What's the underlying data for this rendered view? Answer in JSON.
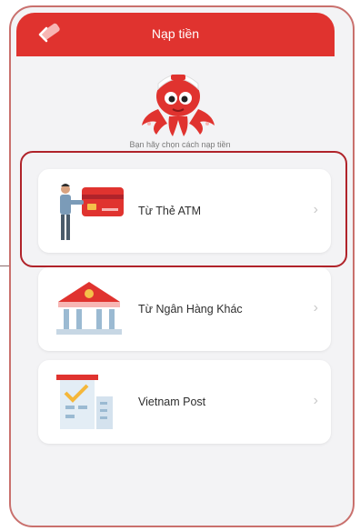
{
  "header": {
    "title": "Nạp tiền",
    "back_icon": "chevron-left-icon"
  },
  "subtitle": "Bạn hãy chọn cách nạp tiền",
  "options": [
    {
      "label": "Từ Thẻ ATM",
      "icon": "atm-card-person-icon"
    },
    {
      "label": "Từ Ngân Hàng Khác",
      "icon": "bank-building-icon"
    },
    {
      "label": "Vietnam Post",
      "icon": "post-office-icon"
    }
  ],
  "colors": {
    "accent": "#e0332f",
    "highlight": "#b0232a"
  }
}
